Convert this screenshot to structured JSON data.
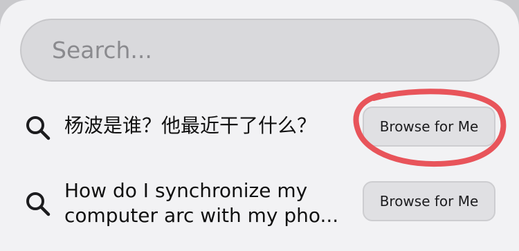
{
  "search": {
    "placeholder": "Search..."
  },
  "suggestions": [
    {
      "icon": "search-icon",
      "query": "杨波是谁？他最近干了什么？",
      "button_label": "Browse for Me"
    },
    {
      "icon": "search-icon",
      "query": "How do I synchronize my computer arc with my pho...",
      "button_label": "Browse for Me"
    }
  ],
  "annotation": {
    "color": "#e8545a"
  }
}
